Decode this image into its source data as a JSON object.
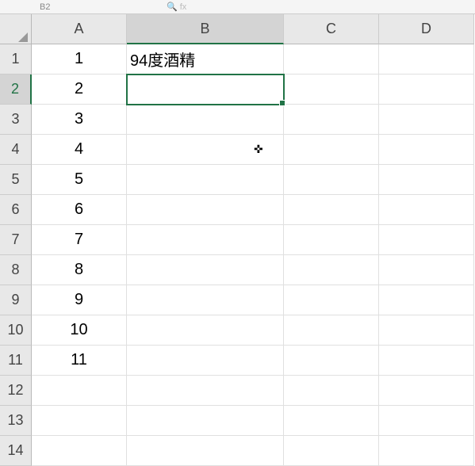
{
  "nameBox": "B2",
  "fxHint": "fx",
  "columns": [
    "A",
    "B",
    "C",
    "D"
  ],
  "activeColumn": "B",
  "activeRow": 2,
  "activeCell": {
    "row": 2,
    "col": "B"
  },
  "rowCount": 14,
  "cells": {
    "A1": "1",
    "A2": "2",
    "A3": "3",
    "A4": "4",
    "A5": "5",
    "A6": "6",
    "A7": "7",
    "A8": "8",
    "A9": "9",
    "A10": "10",
    "A11": "11",
    "B1": "94度酒精"
  },
  "chart_data": {
    "type": "table",
    "columns": [
      "A",
      "B",
      "C",
      "D"
    ],
    "rows": [
      {
        "A": "1",
        "B": "94度酒精",
        "C": "",
        "D": ""
      },
      {
        "A": "2",
        "B": "",
        "C": "",
        "D": ""
      },
      {
        "A": "3",
        "B": "",
        "C": "",
        "D": ""
      },
      {
        "A": "4",
        "B": "",
        "C": "",
        "D": ""
      },
      {
        "A": "5",
        "B": "",
        "C": "",
        "D": ""
      },
      {
        "A": "6",
        "B": "",
        "C": "",
        "D": ""
      },
      {
        "A": "7",
        "B": "",
        "C": "",
        "D": ""
      },
      {
        "A": "8",
        "B": "",
        "C": "",
        "D": ""
      },
      {
        "A": "9",
        "B": "",
        "C": "",
        "D": ""
      },
      {
        "A": "10",
        "B": "",
        "C": "",
        "D": ""
      },
      {
        "A": "11",
        "B": "",
        "C": "",
        "D": ""
      },
      {
        "A": "",
        "B": "",
        "C": "",
        "D": ""
      },
      {
        "A": "",
        "B": "",
        "C": "",
        "D": ""
      },
      {
        "A": "",
        "B": "",
        "C": "",
        "D": ""
      }
    ]
  }
}
